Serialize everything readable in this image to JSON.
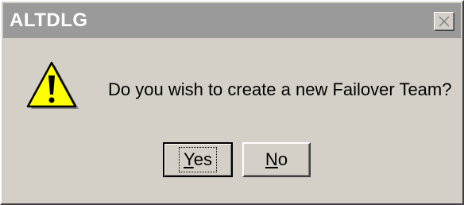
{
  "dialog": {
    "title": "ALTDLG",
    "message": "Do you wish to create a new Failover Team?",
    "icon": "warning-icon",
    "close_icon": "close-icon"
  },
  "buttons": {
    "yes": {
      "mnemonic": "Y",
      "rest": "es"
    },
    "no": {
      "mnemonic": "N",
      "rest": "o"
    }
  },
  "colors": {
    "titlebar": "#9a9a9a",
    "face": "#d4d0c8",
    "warning_fill": "#ffff00"
  }
}
